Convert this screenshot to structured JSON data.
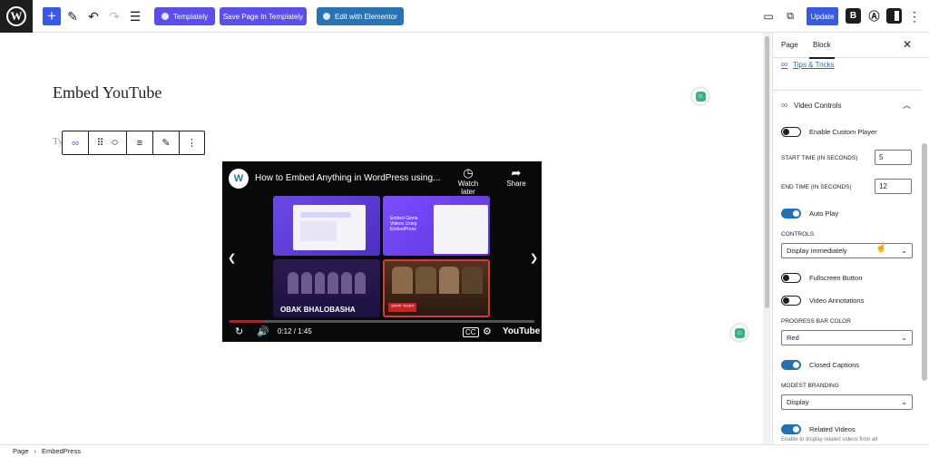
{
  "toolbar": {
    "templately_label": "Templately",
    "save_template_label": "Save Page In Templately",
    "elementor_label": "Edit with Elementor",
    "update_label": "Update"
  },
  "editor": {
    "page_title": "Embed YouTube",
    "block_hint": "Ty"
  },
  "video": {
    "title": "How to Embed Anything in WordPress using...",
    "channel_initial": "W",
    "watch_later": "Watch later",
    "share": "Share",
    "time": "0:12 / 1:45",
    "progress_fraction": 0.114,
    "tile_b_text": "Embed Gloria Videos Using EmbedPress",
    "tile_c_text": "OBAK BHALOBASHA",
    "tile_d_text": "বাংলা সংবাদ",
    "youtube_logo": "YouTube",
    "accent": "#ff0000"
  },
  "sidebar": {
    "tabs": [
      "Page",
      "Block"
    ],
    "tips_link": "Tips & Tricks",
    "section_title": "Video Controls",
    "enable_custom_player": "Enable Custom Player",
    "start_time_label": "START TIME (IN SECONDS)",
    "start_time_value": "5",
    "end_time_label": "END TIME (IN SECONDS)",
    "end_time_value": "12",
    "auto_play": "Auto Play",
    "controls_label": "CONTROLS",
    "controls_value": "Display immediately",
    "fullscreen_button": "Fullscreen Button",
    "video_annotations": "Video Annotations",
    "progress_bar_color_label": "PROGRESS BAR COLOR",
    "progress_bar_color_value": "Red",
    "closed_captions": "Closed Captions",
    "modest_branding_label": "MODEST BRANDING",
    "modest_branding_value": "Display",
    "related_videos": "Related Videos",
    "help_text": "Enable to display related videos from all",
    "toggle_on_color": "#2271b1"
  },
  "footer": {
    "crumb_root": "Page",
    "crumb_current": "EmbedPress"
  }
}
